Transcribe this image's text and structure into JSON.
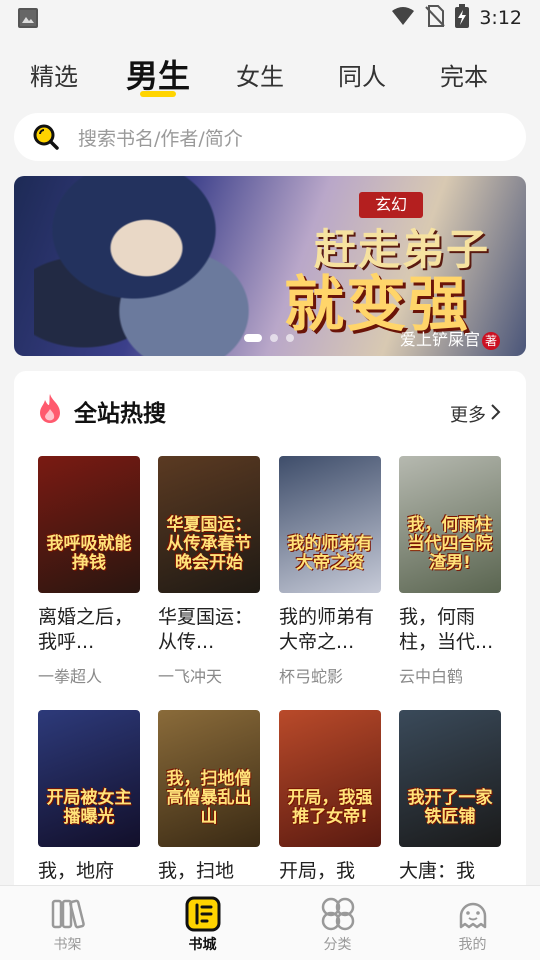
{
  "status_bar": {
    "time": "3:12"
  },
  "tabs": [
    {
      "label": "精选"
    },
    {
      "label": "男生",
      "active": true
    },
    {
      "label": "女生"
    },
    {
      "label": "同人"
    },
    {
      "label": "完本"
    }
  ],
  "search": {
    "placeholder": "搜索书名/作者/简介"
  },
  "banner": {
    "tag": "玄幻",
    "title_line1": "赶走弟子",
    "title_line2": "就变强",
    "author": "爱上铲屎官",
    "author_badge": "著",
    "dot_count": 3,
    "active_dot": 0
  },
  "hot_section": {
    "title": "全站热搜",
    "more_label": "更多",
    "books": [
      {
        "title": "离婚之后，我呼...",
        "author": "一拳超人",
        "cover_text": "我呼吸就能挣钱",
        "cover_colors": [
          "#7a1a12",
          "#2a1610"
        ]
      },
      {
        "title": "华夏国运：从传...",
        "author": "一飞冲天",
        "cover_text": "华夏国运：从传承春节晚会开始",
        "cover_colors": [
          "#5b3a22",
          "#1f1a14"
        ]
      },
      {
        "title": "我的师弟有大帝之...",
        "author": "杯弓蛇影",
        "cover_text": "我的师弟有大帝之资",
        "cover_colors": [
          "#3e4d6a",
          "#c7cbd8"
        ]
      },
      {
        "title": "我，何雨柱，当代...",
        "author": "云中白鹤",
        "cover_text": "我，何雨柱当代四合院渣男!",
        "cover_colors": [
          "#b6b9b0",
          "#5a6550"
        ]
      },
      {
        "title": "我，地府",
        "author": "",
        "cover_text": "开局被女主播曝光",
        "cover_colors": [
          "#2d3a7a",
          "#120f2a"
        ]
      },
      {
        "title": "我，扫地",
        "author": "",
        "cover_text": "我，扫地僧高僧暴乱出山",
        "cover_colors": [
          "#8a6b3a",
          "#3a2a14"
        ]
      },
      {
        "title": "开局，我",
        "author": "",
        "cover_text": "开局，我强推了女帝!",
        "cover_colors": [
          "#b94a2a",
          "#5a1a10"
        ]
      },
      {
        "title": "大唐：我",
        "author": "",
        "cover_text": "我开了一家铁匠铺",
        "cover_colors": [
          "#3a4a5a",
          "#1a1a1a"
        ]
      }
    ]
  },
  "bottom_nav": [
    {
      "label": "书架",
      "icon": "bookshelf-icon"
    },
    {
      "label": "书城",
      "icon": "bookstore-icon",
      "active": true
    },
    {
      "label": "分类",
      "icon": "category-icon"
    },
    {
      "label": "我的",
      "icon": "profile-icon"
    }
  ],
  "colors": {
    "accent": "#ffd400",
    "text": "#222222",
    "muted": "#8a8a8a"
  }
}
